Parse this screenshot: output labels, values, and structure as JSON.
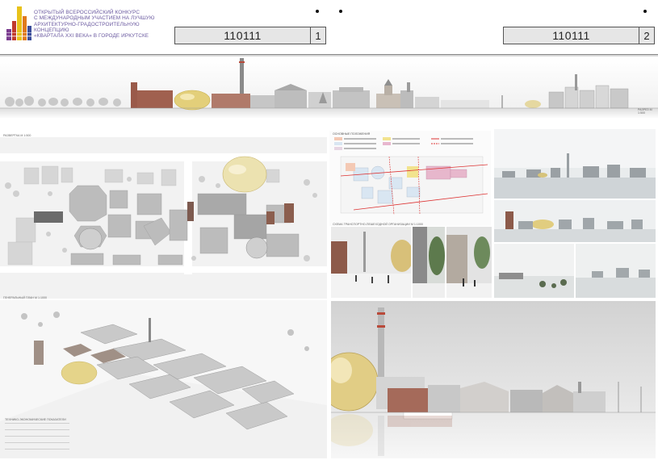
{
  "header": {
    "title_lines": [
      "ОТКРЫТЫЙ ВСЕРОССИЙСКИЙ КОНКУРС",
      "С МЕЖДУНАРОДНЫМ УЧАСТИЕМ НА ЛУЧШУЮ",
      "АРХИТЕКТУРНО-ГРАДОСТРОИТЕЛЬНУЮ КОНЦЕПЦИЮ",
      "«КВАРТАЛА XXI ВЕКА» В ГОРОДЕ ИРКУТСКЕ"
    ],
    "sheet1": {
      "code": "110111",
      "number": "1"
    },
    "sheet2": {
      "code": "110111",
      "number": "2"
    }
  },
  "labels": {
    "elevation_left": "РАЗВЕРТКА М 1:500",
    "plan": "ГЕНЕРАЛЬНЫЙ ПЛАН М 1:1000",
    "elevation_right": "РАЗРЕЗ М 1:500",
    "scheme_title": "ОСНОВНЫЕ ПОЛОЖЕНИЯ",
    "scheme_caption": "СХЕМА ТРАНСПОРТНО-ПЕШЕХОДНОЙ ОРГАНИЗАЦИИ М 1:1000",
    "table_title": "ТЕХНИКО-ЭКОНОМИЧЕСКИЕ ПОКАЗАТЕЛИ"
  },
  "colors": {
    "brand_purple": "#6b5aa0",
    "logo_colors": [
      "#e8c21a",
      "#e07a1c",
      "#c0392b",
      "#7a3b8f",
      "#3b4d9a"
    ]
  }
}
